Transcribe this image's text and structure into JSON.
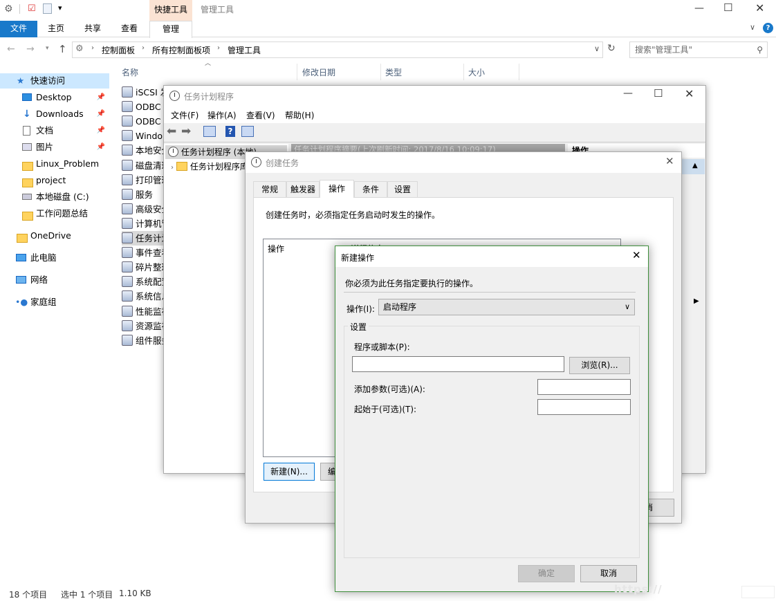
{
  "ribbon": {
    "group_label": "快捷工具",
    "window_title": "管理工具",
    "tabs": [
      "文件",
      "主页",
      "共享",
      "查看",
      "管理"
    ]
  },
  "address": {
    "crumbs": [
      "控制面板",
      "所有控制面板项",
      "管理工具"
    ],
    "search_placeholder": "搜索\"管理工具\""
  },
  "nav": {
    "quick_access": "快速访问",
    "items": [
      "Desktop",
      "Downloads",
      "文档",
      "图片",
      "Linux_Problem",
      "project",
      "本地磁盘 (C:)",
      "工作问题总结"
    ],
    "onedrive": "OneDrive",
    "this_pc": "此电脑",
    "network": "网络",
    "homegroup": "家庭组"
  },
  "columns": {
    "name": "名称",
    "date": "修改日期",
    "type": "类型",
    "size": "大小"
  },
  "files": [
    "iSCSI 发",
    "ODBC",
    "ODBC",
    "Windo",
    "本地安全",
    "磁盘清理",
    "打印管理",
    "服务",
    "高级安全",
    "计算机管",
    "任务计划",
    "事件查看",
    "碎片整理",
    "系统配置",
    "系统信息",
    "性能监视",
    "资源监视",
    "组件服务"
  ],
  "status": {
    "count": "18 个项目",
    "selected": "选中 1 个项目",
    "size": "1.10 KB"
  },
  "ts": {
    "title": "任务计划程序",
    "menu": [
      "文件(F)",
      "操作(A)",
      "查看(V)",
      "帮助(H)"
    ],
    "tree_root": "任务计划程序 (本地)",
    "tree_child": "任务计划程序库",
    "summary": "任务计划程序摘要(上次刷新时间: 2017/8/16 10:09:17)",
    "actions_header": "操作"
  },
  "ct": {
    "title": "创建任务",
    "tabs": [
      "常规",
      "触发器",
      "操作",
      "条件",
      "设置"
    ],
    "hint": "创建任务时，必须指定任务启动时发生的操作。",
    "col_action": "操作",
    "col_detail": "详细信息",
    "new_btn": "新建(N)...",
    "edit_btn": "编",
    "cancel_btn": "消"
  },
  "na": {
    "title": "新建操作",
    "hint": "你必须为此任务指定要执行的操作。",
    "action_label": "操作(I):",
    "action_value": "启动程序",
    "settings_label": "设置",
    "program_label": "程序或脚本(P):",
    "program_value": "",
    "browse": "浏览(R)...",
    "args_label": "添加参数(可选)(A):",
    "args_value": "",
    "start_label": "起始于(可选)(T):",
    "start_value": "",
    "ok": "确定",
    "cancel": "取消"
  },
  "watermark": "https://"
}
